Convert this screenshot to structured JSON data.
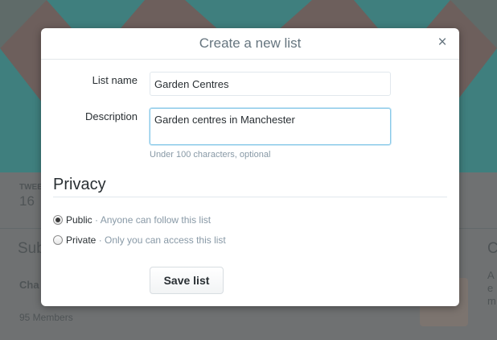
{
  "background": {
    "tweets_label": "TWEE",
    "tweets_count": "16",
    "subscribers_heading": "Sub",
    "list_name": "Cha",
    "members": "95 Members",
    "right_heading": "C",
    "right_text_1": "A",
    "right_text_2": "e",
    "right_text_3": "m"
  },
  "modal": {
    "title": "Create a new list",
    "close_glyph": "×",
    "list_name_label": "List name",
    "list_name_value": "Garden Centres",
    "description_label": "Description",
    "description_value": "Garden centres in Manchester",
    "description_hint": "Under 100 characters, optional",
    "privacy_heading": "Privacy",
    "public_label": "Public",
    "public_desc": "· Anyone can follow this list",
    "private_label": "Private",
    "private_desc": "· Only you can access this list",
    "selected_privacy": "Public",
    "save_label": "Save list"
  },
  "colors": {
    "header_teal": "#3f7f7e",
    "header_rose": "#6d5f5c",
    "focus_border": "#88c9e8"
  }
}
